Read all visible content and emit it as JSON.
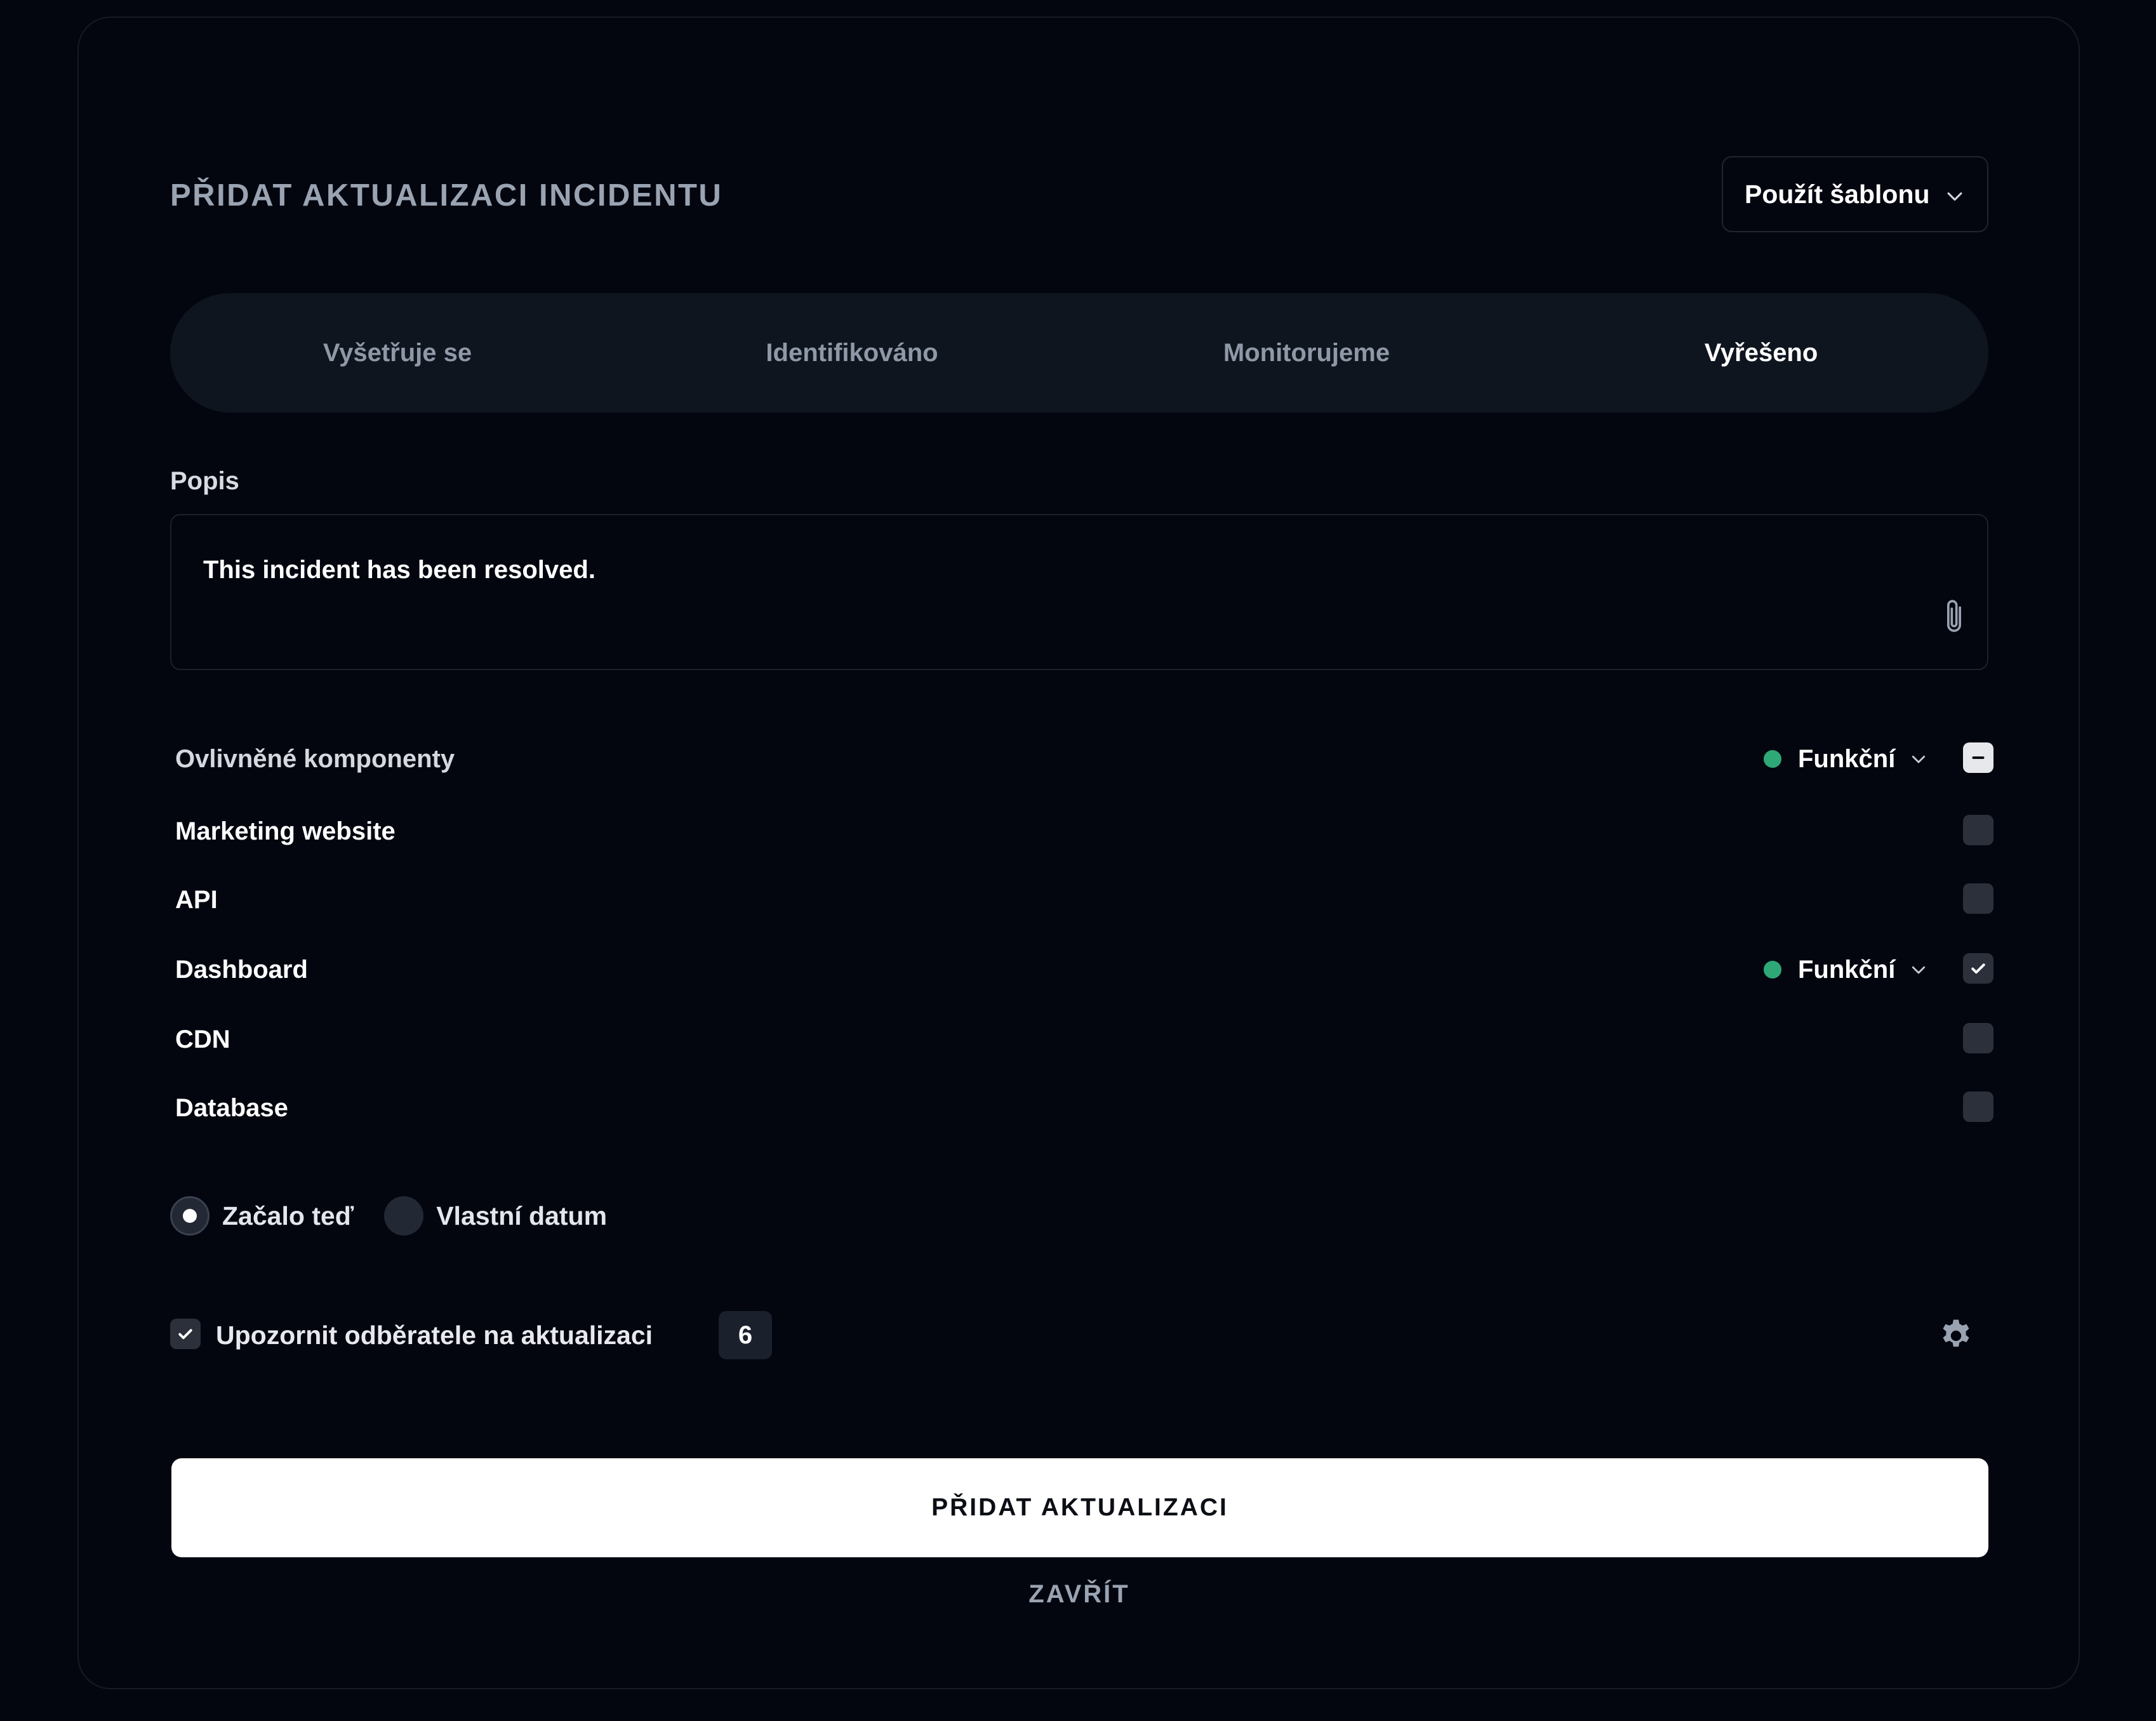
{
  "modal": {
    "title": "PŘIDAT AKTUALIZACI INCIDENTU",
    "template_button": "Použít šablonu"
  },
  "tabs": [
    {
      "label": "Vyšetřuje se",
      "active": false
    },
    {
      "label": "Identifikováno",
      "active": false
    },
    {
      "label": "Monitorujeme",
      "active": false
    },
    {
      "label": "Vyřešeno",
      "active": true
    }
  ],
  "description": {
    "label": "Popis",
    "value": "This incident has been resolved."
  },
  "components": {
    "header_label": "Ovlivněné komponenty",
    "header_status": "Funkční",
    "status_color": "#2ea876",
    "items": [
      {
        "name": "Marketing website",
        "checked": false
      },
      {
        "name": "API",
        "checked": false
      },
      {
        "name": "Dashboard",
        "checked": true,
        "status": "Funkční"
      },
      {
        "name": "CDN",
        "checked": false
      },
      {
        "name": "Database",
        "checked": false
      }
    ]
  },
  "timing": {
    "option_now": "Začalo teď",
    "option_custom": "Vlastní datum",
    "selected": "now"
  },
  "notify": {
    "label": "Upozornit odběratele na aktualizaci",
    "count": "6",
    "checked": true
  },
  "actions": {
    "submit": "PŘIDAT AKTUALIZACI",
    "close": "ZAVŘÍT"
  }
}
